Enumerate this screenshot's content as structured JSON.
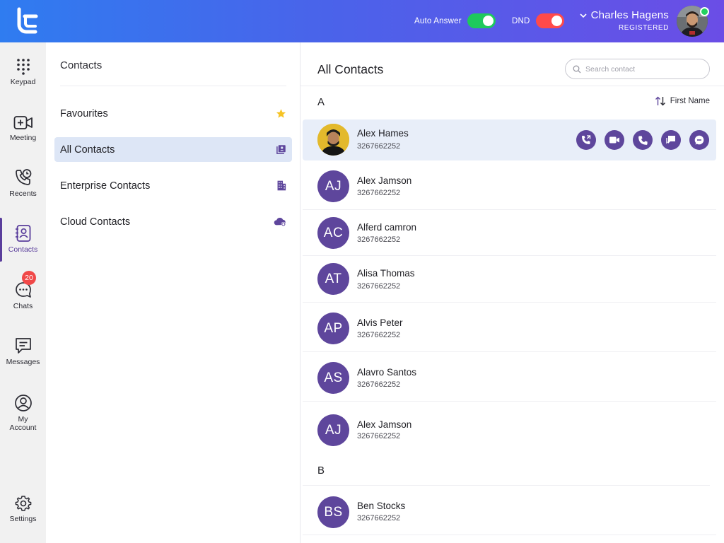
{
  "header": {
    "auto_answer_label": "Auto Answer",
    "dnd_label": "DND",
    "user_name": "Charles Hagens",
    "user_status": "REGISTERED",
    "auto_answer_on": true,
    "dnd_on": true,
    "colors": {
      "gradient_start": "#2f7cf0",
      "gradient_end": "#6b4de6",
      "toggle_on": "#1ec95c",
      "dnd": "#ff4a4a",
      "online": "#23d160"
    }
  },
  "nav": {
    "items": [
      {
        "label": "Keypad",
        "icon": "keypad-icon"
      },
      {
        "label": "Meeting",
        "icon": "video-plus-icon"
      },
      {
        "label": "Recents",
        "icon": "recent-calls-icon"
      },
      {
        "label": "Contacts",
        "icon": "contacts-book-icon",
        "active": true
      },
      {
        "label": "Chats",
        "icon": "chat-bubble-icon",
        "badge": "20"
      },
      {
        "label": "Messages",
        "icon": "message-icon"
      },
      {
        "label": "My Account",
        "icon": "user-circle-icon"
      },
      {
        "label": "Settings",
        "icon": "gear-icon"
      }
    ]
  },
  "panel": {
    "title": "Contacts",
    "categories": [
      {
        "label": "Favourites",
        "icon": "star-icon"
      },
      {
        "label": "All Contacts",
        "icon": "contact-card-icon",
        "active": true
      },
      {
        "label": "Enterprise Contacts",
        "icon": "building-icon"
      },
      {
        "label": "Cloud Contacts",
        "icon": "cloud-sync-icon"
      }
    ]
  },
  "main": {
    "title": "All Contacts",
    "search_placeholder": "Search contact",
    "sort_label": "First Name",
    "groups": [
      {
        "letter": "A"
      },
      {
        "letter": "B"
      }
    ],
    "contacts": [
      {
        "name": "Alex Hames",
        "phone": "3267662252",
        "initials": "",
        "photo": true,
        "selected": true
      },
      {
        "name": "Alex Jamson",
        "phone": "3267662252",
        "initials": "AJ"
      },
      {
        "name": "Alferd camron",
        "phone": "3267662252",
        "initials": "AC"
      },
      {
        "name": "Alisa Thomas",
        "phone": "3267662252",
        "initials": "AT"
      },
      {
        "name": "Alvis Peter",
        "phone": "3267662252",
        "initials": "AP"
      },
      {
        "name": "Alavro Santos",
        "phone": "3267662252",
        "initials": "AS"
      },
      {
        "name": "Alex Jamson",
        "phone": "3267662252",
        "initials": "AJ"
      },
      {
        "name": "Ben Stocks",
        "phone": "3267662252",
        "initials": "BS"
      }
    ],
    "row_actions": [
      "call-forward-icon",
      "video-call-icon",
      "phone-icon",
      "chat-icon",
      "message-bubble-icon"
    ],
    "colors": {
      "accent": "#5e469c",
      "selected_row": "#e8eef9"
    }
  }
}
